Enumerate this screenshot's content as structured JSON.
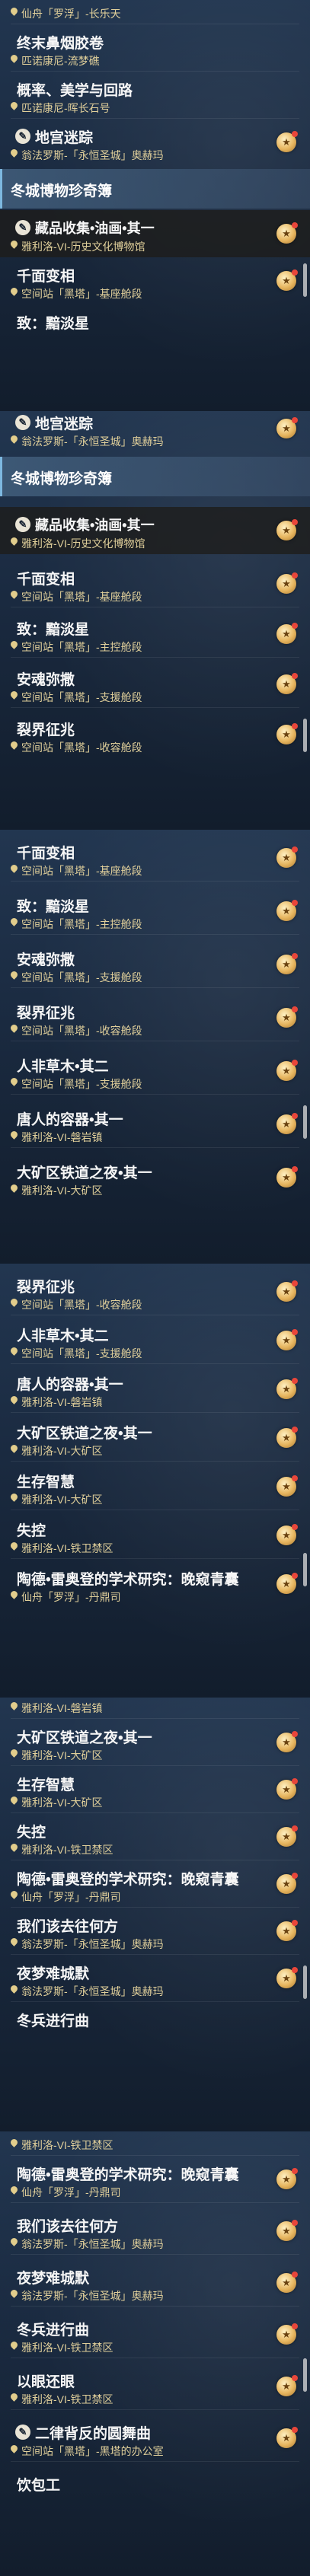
{
  "sections": [
    {
      "id": "s1",
      "title": "冬城博物珍奇簿",
      "rows": [
        {
          "title": "",
          "location": "仙舟「罗浮」-长乐天",
          "icon": false
        },
        {
          "title": "终末鼻烟胶卷",
          "location": "匹诺康尼-流梦礁",
          "icon": false
        },
        {
          "title": "概率、美学与回路",
          "location": "匹诺康尼-晖长石号",
          "icon": false
        },
        {
          "title": "地宫迷踪",
          "location": "翁法罗斯-「永恒圣城」奥赫玛",
          "icon": true
        },
        {
          "title": "藏品收集•油画•其一",
          "location": "雅利洛-VI-历史文化博物馆",
          "icon": true
        },
        {
          "title": "千面变相",
          "location": "空间站「黑塔」-基座舱段",
          "icon": false
        },
        {
          "title": "致：黯淡星",
          "location": "",
          "icon": false
        }
      ]
    },
    {
      "id": "s2",
      "title": "冬城博物珍奇簿",
      "rows": [
        {
          "title": "地宫迷踪",
          "location": "翁法罗斯-「永恒圣城」奥赫玛",
          "icon": true
        },
        {
          "title": "藏品收集•油画•其一",
          "location": "雅利洛-VI-历史文化博物馆",
          "icon": true
        },
        {
          "title": "千面变相",
          "location": "空间站「黑塔」-基座舱段",
          "icon": false
        },
        {
          "title": "致：黯淡星",
          "location": "空间站「黑塔」-主控舱段",
          "icon": false
        },
        {
          "title": "安魂弥撒",
          "location": "空间站「黑塔」-支援舱段",
          "icon": false
        },
        {
          "title": "裂界征兆",
          "location": "空间站「黑塔」-收容舱段",
          "icon": false
        }
      ]
    },
    {
      "id": "s3",
      "rows": [
        {
          "title": "千面变相",
          "location": "空间站「黑塔」-基座舱段"
        },
        {
          "title": "致：黯淡星",
          "location": "空间站「黑塔」-主控舱段"
        },
        {
          "title": "安魂弥撒",
          "location": "空间站「黑塔」-支援舱段"
        },
        {
          "title": "裂界征兆",
          "location": "空间站「黑塔」-收容舱段"
        },
        {
          "title": "人非草木•其二",
          "location": "空间站「黑塔」-支援舱段"
        },
        {
          "title": "唐人的容器•其一",
          "location": "雅利洛-VI-磐岩镇"
        },
        {
          "title": "大矿区铁道之夜•其一",
          "location": "雅利洛-VI-大矿区"
        }
      ]
    },
    {
      "id": "s4",
      "rows": [
        {
          "title": "裂界征兆",
          "location": "空间站「黑塔」-收容舱段"
        },
        {
          "title": "人非草木•其二",
          "location": "空间站「黑塔」-支援舱段"
        },
        {
          "title": "唐人的容器•其一",
          "location": "雅利洛-VI-磐岩镇"
        },
        {
          "title": "大矿区铁道之夜•其一",
          "location": "雅利洛-VI-大矿区"
        },
        {
          "title": "生存智慧",
          "location": "雅利洛-VI-大矿区"
        },
        {
          "title": "失控",
          "location": "雅利洛-VI-铁卫禁区"
        },
        {
          "title": "陶德•雷奥登的学术研究：晚窥青囊",
          "location": "仙舟「罗浮」-丹鼎司"
        }
      ]
    },
    {
      "id": "s5",
      "rows": [
        {
          "title": "",
          "location": "雅利洛-VI-磐岩镇"
        },
        {
          "title": "大矿区铁道之夜•其一",
          "location": "雅利洛-VI-大矿区"
        },
        {
          "title": "生存智慧",
          "location": "雅利洛-VI-大矿区"
        },
        {
          "title": "失控",
          "location": "雅利洛-VI-铁卫禁区"
        },
        {
          "title": "陶德•雷奥登的学术研究：晚窥青囊",
          "location": "仙舟「罗浮」-丹鼎司"
        },
        {
          "title": "我们该去往何方",
          "location": "翁法罗斯-「永恒圣城」奥赫玛"
        },
        {
          "title": "夜梦难城默",
          "location": "翁法罗斯-「永恒圣城」奥赫玛"
        },
        {
          "title": "冬兵进行曲",
          "location": ""
        }
      ]
    },
    {
      "id": "s6",
      "rows": [
        {
          "title": "",
          "location": "雅利洛-VI-铁卫禁区"
        },
        {
          "title": "陶德•雷奥登的学术研究：晚窥青囊",
          "location": "仙舟「罗浮」-丹鼎司"
        },
        {
          "title": "我们该去往何方",
          "location": "翁法罗斯-「永恒圣城」奥赫玛"
        },
        {
          "title": "夜梦难城默",
          "location": "翁法罗斯-「永恒圣城」奥赫玛"
        },
        {
          "title": "冬兵进行曲",
          "location": "雅利洛-VI-铁卫禁区"
        },
        {
          "title": "以眼还眼",
          "location": "雅利洛-VI-铁卫禁区"
        },
        {
          "title": "二律背反的圆舞曲",
          "location": "空间站「黑塔」-黑塔的办公室"
        },
        {
          "title": "饮包工",
          "location": ""
        }
      ]
    }
  ]
}
